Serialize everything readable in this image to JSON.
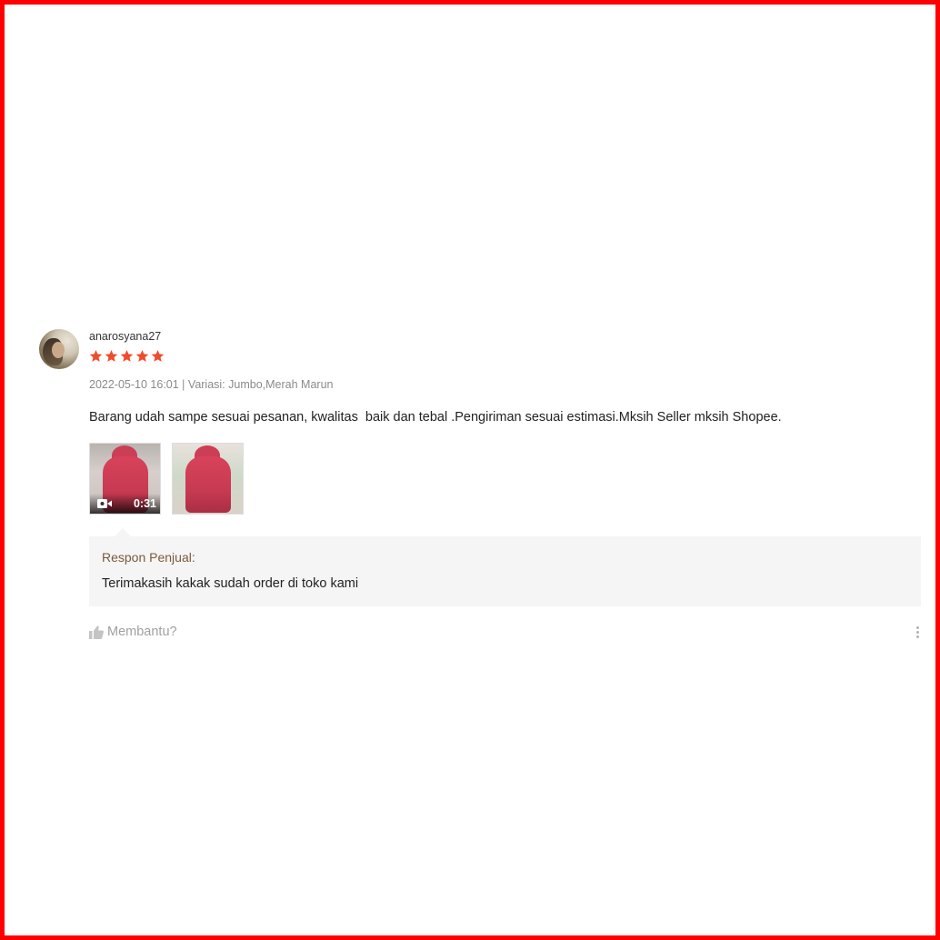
{
  "review": {
    "username": "anarosyana27",
    "rating": 5,
    "rating_max": 5,
    "star_color": "#ee4d2d",
    "date": "2022-05-10 16:01",
    "separator": " | ",
    "variation_label": "Variasi: ",
    "variation_value": "Jumbo,Merah Marun",
    "comment": "Barang udah sampe sesuai pesanan, kwalitas  baik dan tebal .Pengiriman sesuai estimasi.Mksih Seller mksih Shopee.",
    "media": [
      {
        "type": "video",
        "icon": "video-camera-icon",
        "duration": "0:31"
      },
      {
        "type": "image"
      }
    ],
    "seller_response": {
      "title": "Respon Penjual:",
      "text": "Terimakasih kakak sudah order di toko kami"
    },
    "helpful_label": "Membantu?",
    "helpful_icon": "thumbs-up-icon",
    "more_icon": "more-vertical-icon"
  }
}
